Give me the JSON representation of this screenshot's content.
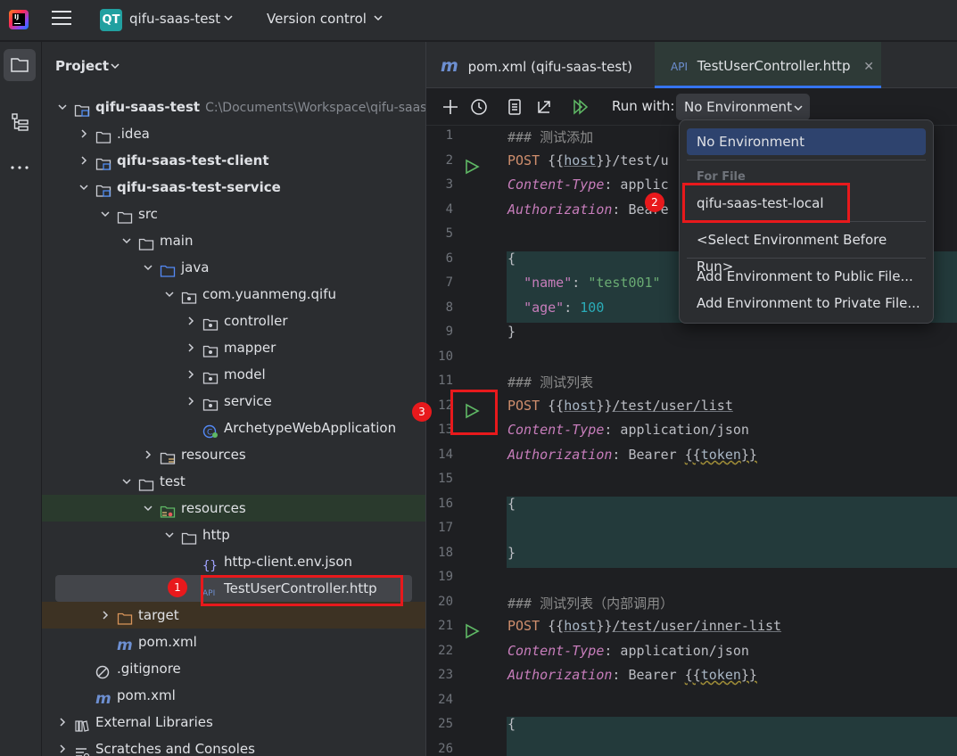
{
  "titlebar": {
    "project_badge": "QT",
    "project_name": "qifu-saas-test",
    "vcs_label": "Version control"
  },
  "project_panel": {
    "title": "Project",
    "tree": [
      {
        "label": "qifu-saas-test",
        "path": "C:\\Documents\\Workspace\\qifu-saas",
        "depth": 0,
        "expanded": true,
        "icon": "module-folder-icon",
        "bold": true
      },
      {
        "label": ".idea",
        "depth": 1,
        "expanded": false,
        "icon": "folder-icon"
      },
      {
        "label": "qifu-saas-test-client",
        "depth": 1,
        "expanded": false,
        "icon": "module-folder-icon",
        "bold": true
      },
      {
        "label": "qifu-saas-test-service",
        "depth": 1,
        "expanded": true,
        "icon": "module-folder-icon",
        "bold": true
      },
      {
        "label": "src",
        "depth": 2,
        "expanded": true,
        "icon": "folder-icon"
      },
      {
        "label": "main",
        "depth": 3,
        "expanded": true,
        "icon": "folder-icon"
      },
      {
        "label": "java",
        "depth": 4,
        "expanded": true,
        "icon": "source-folder-icon"
      },
      {
        "label": "com.yuanmeng.qifu",
        "depth": 5,
        "expanded": true,
        "icon": "package-icon"
      },
      {
        "label": "controller",
        "depth": 6,
        "expanded": false,
        "icon": "package-icon"
      },
      {
        "label": "mapper",
        "depth": 6,
        "expanded": false,
        "icon": "package-icon"
      },
      {
        "label": "model",
        "depth": 6,
        "expanded": false,
        "icon": "package-icon"
      },
      {
        "label": "service",
        "depth": 6,
        "expanded": false,
        "icon": "package-icon"
      },
      {
        "label": "ArchetypeWebApplication",
        "depth": 6,
        "leaf": true,
        "icon": "spring-class-icon"
      },
      {
        "label": "resources",
        "depth": 4,
        "expanded": false,
        "icon": "resources-folder-icon"
      },
      {
        "label": "test",
        "depth": 3,
        "expanded": true,
        "icon": "folder-icon"
      },
      {
        "label": "resources",
        "depth": 4,
        "expanded": true,
        "icon": "test-resources-folder-icon",
        "style": "green"
      },
      {
        "label": "http",
        "depth": 5,
        "expanded": true,
        "icon": "folder-icon"
      },
      {
        "label": "http-client.env.json",
        "depth": 6,
        "leaf": true,
        "icon": "json-file-icon"
      },
      {
        "label": "TestUserController.http",
        "depth": 6,
        "leaf": true,
        "icon": "http-file-icon",
        "style": "selected"
      },
      {
        "label": "target",
        "depth": 2,
        "expanded": false,
        "icon": "excluded-folder-icon",
        "style": "brown"
      },
      {
        "label": "pom.xml",
        "depth": 2,
        "leaf": true,
        "icon": "maven-icon"
      },
      {
        "label": ".gitignore",
        "depth": 1,
        "leaf": true,
        "icon": "ignore-file-icon"
      },
      {
        "label": "pom.xml",
        "depth": 1,
        "leaf": true,
        "icon": "maven-icon"
      },
      {
        "label": "External Libraries",
        "depth": 0,
        "expanded": false,
        "icon": "libraries-icon"
      },
      {
        "label": "Scratches and Consoles",
        "depth": 0,
        "expanded": false,
        "icon": "scratches-icon"
      }
    ]
  },
  "editor": {
    "tabs": [
      {
        "label": "pom.xml (qifu-saas-test)",
        "icon_text": "m"
      },
      {
        "label": "TestUserController.http",
        "icon_text": "API"
      }
    ],
    "run_with_label": "Run with:",
    "environment_value": "No Environment",
    "line_numbers": [
      "1",
      "2",
      "3",
      "4",
      "5",
      "6",
      "7",
      "8",
      "9",
      "10",
      "11",
      "12",
      "13",
      "14",
      "15",
      "16",
      "17",
      "18",
      "19",
      "20",
      "21",
      "22",
      "23",
      "24",
      "25",
      "26"
    ],
    "code": {
      "l1": "### 测试添加",
      "l2_method": "POST",
      "l2_rest": "/test/u",
      "l3_header": "Content-Type",
      "l3_value": " applic",
      "l4_header": "Authorization",
      "l4_value": " Beare",
      "l6": "{",
      "l7_key": "\"name\"",
      "l7_val": "\"test001\"",
      "l8_key": "\"age\"",
      "l8_val": "100",
      "l9": "}",
      "l11": "### 测试列表",
      "l12_method": "POST",
      "l12_rest": "/test/user/list",
      "l13_header": "Content-Type",
      "l13_value": " application/json",
      "l14_header": "Authorization",
      "l14_value": " Bearer ",
      "l16": "{",
      "l18": "}",
      "l20": "### 测试列表（内部调用）",
      "l21_method": "POST",
      "l21_rest": "/test/user/inner-list",
      "l22_header": "Content-Type",
      "l22_value": " application/json",
      "l23_header": "Authorization",
      "l23_value": " Bearer ",
      "l25": "{",
      "host_var": "host",
      "token_var": "token",
      "open_braces": "{{",
      "close_braces": "}}"
    }
  },
  "env_dropdown": {
    "selected": "No Environment",
    "group_label": "For File",
    "file_env": "qifu-saas-test-local",
    "select_before_run": "<Select Environment Before Run>",
    "add_public": "Add Environment to Public File...",
    "add_private": "Add Environment to Private File..."
  },
  "annotations": {
    "badge_1": "1",
    "badge_2": "2",
    "badge_3": "3"
  },
  "colors": {
    "accent": "#3574f0",
    "run_green": "#5fb865",
    "annotation_red": "#e8191c"
  }
}
